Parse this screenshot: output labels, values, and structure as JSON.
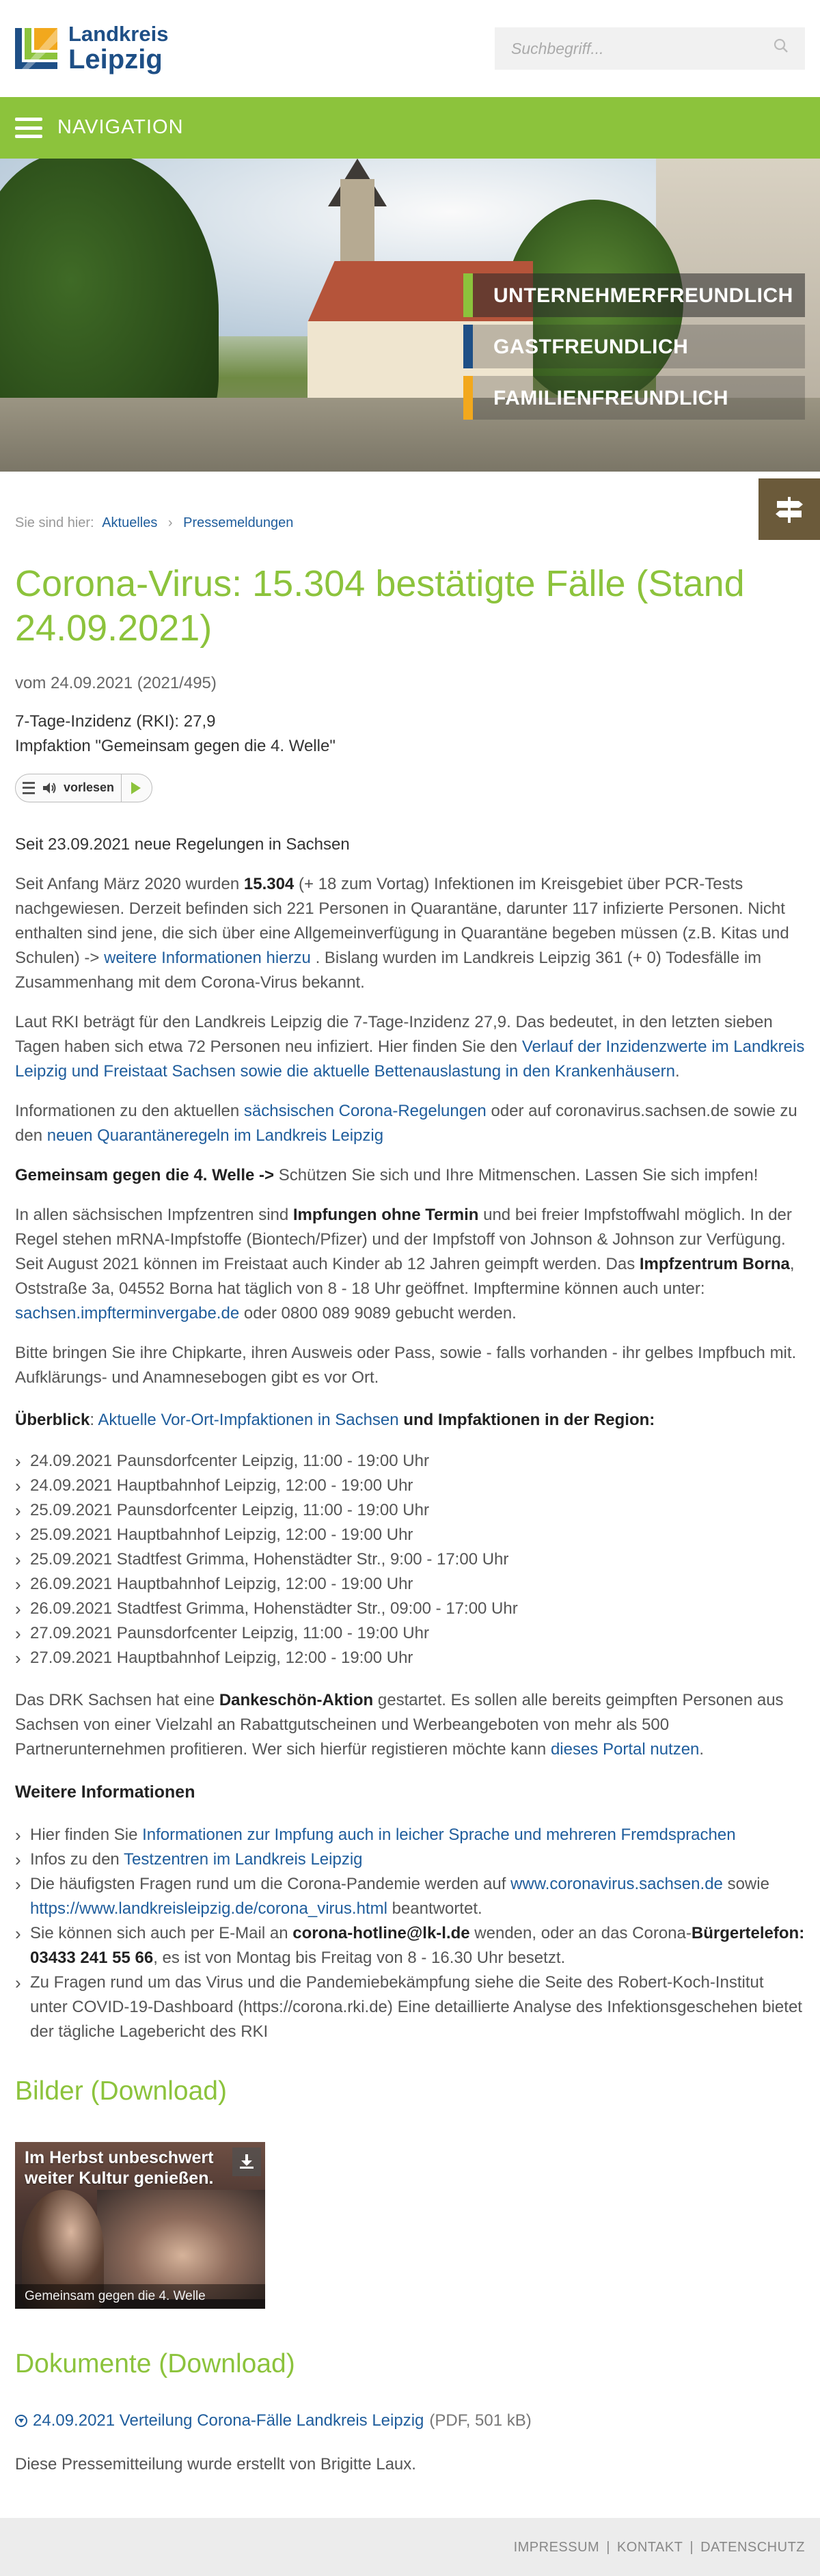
{
  "header": {
    "logo_line1": "Landkreis",
    "logo_line2": "Leipzig",
    "search_placeholder": "Suchbegriff..."
  },
  "nav": {
    "label": "NAVIGATION"
  },
  "hero": {
    "slogans": [
      "UNTERNEHMERFREUNDLICH",
      "GASTFREUNDLICH",
      "FAMILIENFREUNDLICH"
    ]
  },
  "breadcrumb": {
    "prefix": "Sie sind hier:",
    "items": [
      "Aktuelles",
      "Pressemeldungen"
    ],
    "separator": "›"
  },
  "article": {
    "title": "Corona-Virus: 15.304 bestätigte Fälle (Stand 24.09.2021)",
    "date": "vom 24.09.2021 (2021/495)",
    "lead_line1": "7-Tage-Inzidenz (RKI): 27,9",
    "lead_line2": "Impfaktion \"Gemeinsam gegen die 4. Welle\"",
    "player_label": "vorlesen",
    "regeln": "Seit 23.09.2021 neue Regelungen in Sachsen",
    "p1": {
      "a": "Seit Anfang März 2020 wurden ",
      "b": "15.304",
      "c": " (+ 18 zum Vortag) Infektionen im Kreisgebiet über PCR-Tests nachgewiesen. Derzeit befinden sich 221 Personen in Quarantäne, darunter 117 infizierte Personen. Nicht enthalten sind jene, die sich über eine Allgemeinverfügung in Quarantäne begeben müssen (z.B. Kitas und Schulen) -> ",
      "link": "weitere Informationen hierzu",
      "d": " . Bislang wurden im Landkreis Leipzig 361 (+ 0) Todesfälle im Zusammenhang mit dem Corona-Virus bekannt."
    },
    "p2": {
      "a": "Laut RKI beträgt für den Landkreis Leipzig die 7-Tage-Inzidenz 27,9. Das bedeutet, in den letzten sieben Tagen haben sich etwa 72 Personen neu infiziert. Hier finden Sie den ",
      "link": "Verlauf der Inzidenzwerte im Landkreis Leipzig und Freistaat Sachsen sowie die aktuelle Bettenauslastung in den Krankenhäusern",
      "b": "."
    },
    "p3": {
      "a": "Informationen zu den aktuellen ",
      "link1": "sächsischen Corona-Regelungen",
      "b": " oder auf coronavirus.sachsen.de sowie zu den ",
      "link2": "neuen Quarantäneregeln im Landkreis Leipzig"
    },
    "p4": {
      "a": "Gemeinsam gegen die 4. Welle ->",
      "b": " Schützen Sie sich und Ihre Mitmenschen. Lassen Sie sich impfen!"
    },
    "p5": {
      "a": "In allen sächsischen Impfzentren sind ",
      "b": "Impfungen ohne Termin",
      "c": " und bei freier Impfstoffwahl möglich. In der Regel stehen mRNA-Impfstoffe (Biontech/Pfizer) und der Impfstoff von Johnson & Johnson zur Verfügung. Seit August 2021 können im Freistaat auch Kinder ab 12 Jahren geimpft werden. Das ",
      "d": "Impfzentrum Borna",
      "e": ", Oststraße 3a, 04552 Borna hat täglich von 8 - 18 Uhr geöffnet. Impftermine können auch unter: ",
      "link": "sachsen.impfterminvergabe.de",
      "f": " oder 0800 089 9089 gebucht werden."
    },
    "p6": "Bitte bringen Sie ihre Chipkarte, ihren Ausweis oder Pass, sowie - falls vorhanden - ihr gelbes Impfbuch mit. Aufklärungs- und Anamnesebogen gibt es vor Ort.",
    "p7": {
      "a": "Überblick",
      "b": ":  ",
      "link": "Aktuelle Vor-Ort-Impfaktionen in Sachsen",
      "c": " und Impfaktionen in der Region:"
    },
    "impfaktionen": [
      "24.09.2021 Paunsdorfcenter Leipzig, 11:00 - 19:00 Uhr",
      "24.09.2021 Hauptbahnhof Leipzig, 12:00 - 19:00 Uhr",
      "25.09.2021 Paunsdorfcenter Leipzig, 11:00 - 19:00 Uhr",
      "25.09.2021 Hauptbahnhof Leipzig, 12:00 - 19:00 Uhr",
      "25.09.2021 Stadtfest Grimma, Hohenstädter Str., 9:00 - 17:00 Uhr",
      "26.09.2021 Hauptbahnhof Leipzig, 12:00 - 19:00 Uhr",
      "26.09.2021 Stadtfest Grimma, Hohenstädter Str., 09:00 - 17:00 Uhr",
      "27.09.2021 Paunsdorfcenter Leipzig, 11:00 - 19:00 Uhr",
      "27.09.2021 Hauptbahnhof Leipzig, 12:00 - 19:00 Uhr"
    ],
    "p8": {
      "a": "Das DRK Sachsen hat eine ",
      "b": "Dankeschön-Aktion",
      "c": " gestartet. Es sollen alle bereits geimpften Personen aus Sachsen von einer Vielzahl an Rabattgutscheinen und Werbeangeboten von mehr als 500 Partnerunternehmen profitieren. Wer sich hierfür registieren möchte kann ",
      "link": "dieses Portal nutzen",
      "d": "."
    },
    "weitere_heading": "Weitere Informationen",
    "weitere": {
      "i1_a": "Hier finden Sie ",
      "i1_link": "Informationen zur Impfung auch in leicher Sprache und mehreren Fremdsprachen",
      "i2_a": "Infos zu den ",
      "i2_link": "Testzentren im Landkreis Leipzig",
      "i3_a": "Die häufigsten Fragen rund um die Corona-Pandemie werden auf ",
      "i3_link1": "www.coronavirus.sachsen.de",
      "i3_b": "  sowie ",
      "i3_link2": "https://www.landkreisleipzig.de/corona_virus.html",
      "i3_c": " beantwortet.",
      "i4_a": "Sie können sich auch per E-Mail an ",
      "i4_b": "corona-hotline@lk-l.de",
      "i4_c": " wenden, oder an das Corona-",
      "i4_d": "Bürgertelefon: 03433 241 55 66",
      "i4_e": ", es ist von Montag bis Freitag von 8 - 16.30 Uhr besetzt.",
      "i5": "Zu Fragen rund um das Virus und die Pandemiebekämpfung siehe die Seite des Robert-Koch-Institut unter COVID-19-Dashboard (https://corona.rki.de)  Eine detaillierte Analyse des Infektionsgeschehen bietet der tägliche Lagebericht des RKI"
    }
  },
  "bilder": {
    "heading": "Bilder (Download)",
    "image_headline": "Im Herbst unbeschwert weiter Kultur genießen.",
    "caption": "Gemeinsam gegen die 4. Welle"
  },
  "dokumente": {
    "heading": "Dokumente (Download)",
    "link": "24.09.2021 Verteilung Corona-Fälle Landkreis Leipzig",
    "meta": " (PDF, 501 kB)",
    "author": "Diese Pressemitteilung wurde erstellt von Brigitte Laux."
  },
  "footer": {
    "links": [
      "IMPRESSUM",
      "KONTAKT",
      "DATENSCHUTZ"
    ],
    "separator": "|"
  },
  "colors": {
    "brand_green": "#8cc33c",
    "brand_blue": "#1e4f86",
    "accent_orange": "#f2a81d",
    "link": "#1f5d9c"
  }
}
